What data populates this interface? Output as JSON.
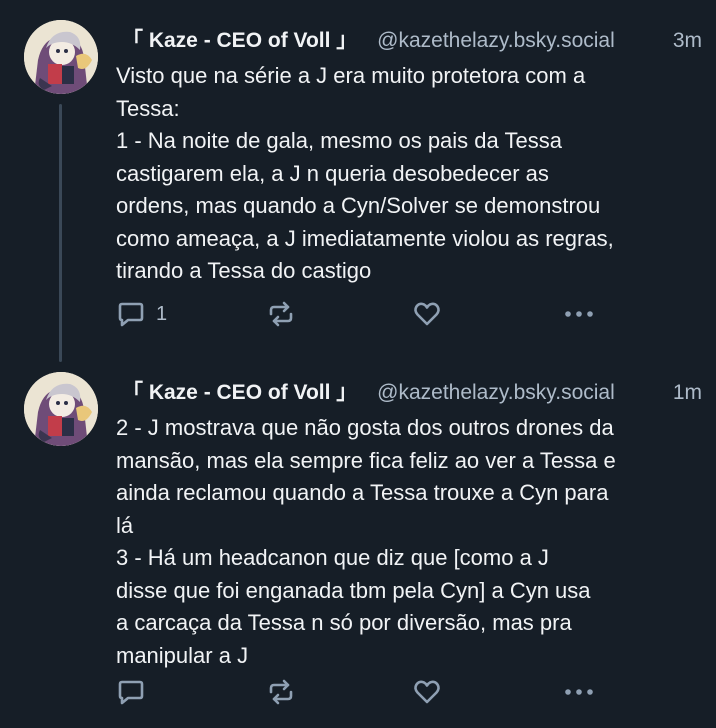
{
  "posts": [
    {
      "author": {
        "display_name": "「 Kaze - CEO of Voll 」",
        "handle": "@kazethelazy.bsky.social"
      },
      "timestamp": "3m",
      "body_lines": [
        "Visto que na série a J era muito protetora com a",
        "Tessa:",
        "1 - Na noite de gala, mesmo os pais da Tessa",
        "castigarem ela, a J n queria desobedecer as",
        "ordens, mas quando a Cyn/Solver se demonstrou",
        "como ameaça, a J imediatamente violou as regras,",
        "tirando a Tessa do castigo"
      ],
      "actions": {
        "reply_count": "1",
        "reply_icon": "speech-bubble-icon",
        "repost_icon": "repost-arrows-icon",
        "like_icon": "heart-icon",
        "more_icon": "ellipsis-icon"
      }
    },
    {
      "author": {
        "display_name": "「 Kaze - CEO of Voll 」",
        "handle": "@kazethelazy.bsky.social"
      },
      "timestamp": "1m",
      "body_lines": [
        "2 - J mostrava que não gosta dos outros drones da",
        "mansão, mas ela sempre fica feliz ao ver a Tessa e",
        "ainda reclamou quando a Tessa trouxe a Cyn para",
        "lá",
        "3 - Há um headcanon que diz que [como a J",
        "disse que foi enganada tbm pela Cyn] a Cyn usa",
        "a carcaça da Tessa n só por diversão, mas pra",
        "manipular a J"
      ],
      "actions": {
        "reply_count": "",
        "reply_icon": "speech-bubble-icon",
        "repost_icon": "repost-arrows-icon",
        "like_icon": "heart-icon",
        "more_icon": "ellipsis-icon"
      }
    }
  ],
  "colors": {
    "background": "#161e27",
    "text_primary": "#f1f3f5",
    "text_secondary": "#aebbc9",
    "icon": "#8fa0b3",
    "thread_line": "#3a4857"
  }
}
